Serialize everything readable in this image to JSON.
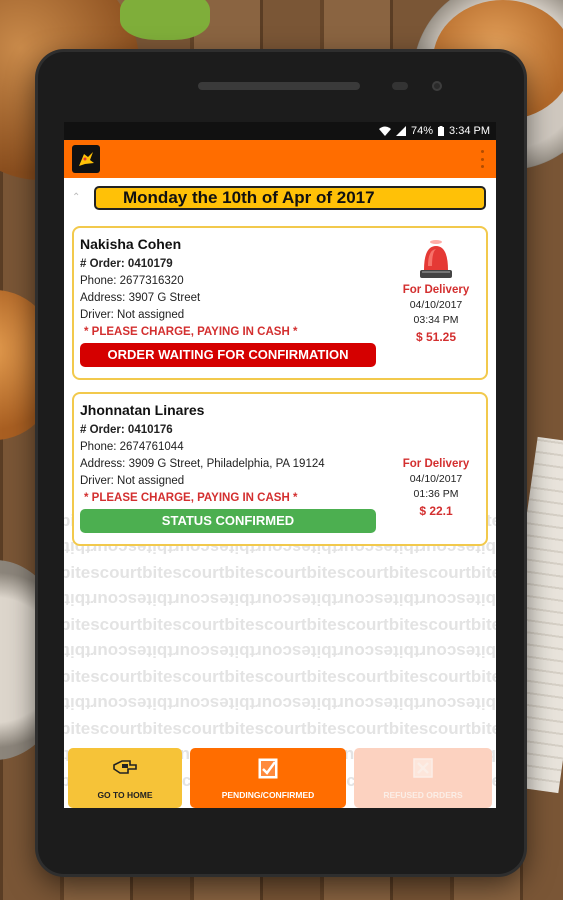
{
  "statusbar": {
    "battery": "74%",
    "time": "3:34 PM"
  },
  "date_header": "Monday the 10th of Apr of 2017",
  "orders": [
    {
      "customer": "Nakisha Cohen",
      "order_label": "# Order: 0410179",
      "phone": "Phone: 2677316320",
      "address": "Address: 3907 G Street",
      "driver": "Driver: Not assigned",
      "cash_note": "* PLEASE CHARGE, PAYING IN CASH *",
      "status": "ORDER WAITING FOR CONFIRMATION",
      "delivery_type": "For Delivery",
      "date": "04/10/2017",
      "time": "03:34 PM",
      "total": "$ 51.25"
    },
    {
      "customer": "Jhonnatan Linares",
      "order_label": "# Order: 0410176",
      "phone": "Phone: 2674761044",
      "address": "Address: 3909 G Street, Philadelphia, PA 19124",
      "driver": "Driver: Not assigned",
      "cash_note": "* PLEASE CHARGE, PAYING IN CASH *",
      "status": "STATUS CONFIRMED",
      "delivery_type": "For Delivery",
      "date": "04/10/2017",
      "time": "01:36 PM",
      "total": "$ 22.1"
    }
  ],
  "watermark_text": "bitescourt",
  "bottom_nav": {
    "home": "GO TO HOME",
    "pending": "PENDING/CONFIRMED",
    "refused": "REFUSED ORDERS"
  },
  "colors": {
    "accent": "#ff6d00",
    "date_bar": "#ffc107",
    "waiting": "#d50000",
    "confirmed": "#4caf50",
    "alert_text": "#d32f2f"
  },
  "icons": [
    "wifi-icon",
    "signal-icon",
    "battery-icon",
    "app-logo-icon",
    "overflow-menu-icon",
    "siren-icon",
    "home-hand-icon",
    "checklist-icon",
    "refused-icon"
  ]
}
